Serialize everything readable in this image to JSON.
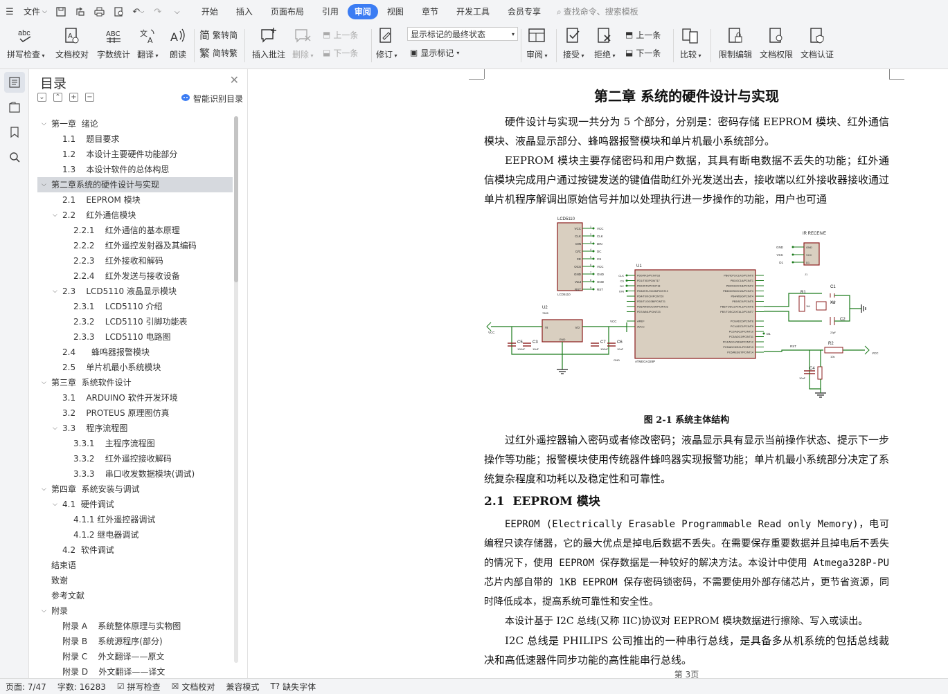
{
  "menubar": {
    "file_label": "文件",
    "tabs": [
      "开始",
      "插入",
      "页面布局",
      "引用",
      "审阅",
      "视图",
      "章节",
      "开发工具",
      "会员专享"
    ],
    "active_tab": "审阅",
    "search_placeholder": "查找命令、搜索模板"
  },
  "ribbon": {
    "spell_check": "拼写检查",
    "doc_proof": "文档校对",
    "word_count": "字数统计",
    "translate": "翻译",
    "read_aloud": "朗读",
    "trad_to_simp": "繁转简",
    "simp_to_trad": "简转繁",
    "insert_comment": "插入批注",
    "delete": "删除",
    "prev_comment": "上一条",
    "next_comment": "下一条",
    "revise": "修订",
    "markup_select": "显示标记的最终状态",
    "show_markup": "显示标记",
    "review": "审阅",
    "accept": "接受",
    "reject": "拒绝",
    "prev_change": "上一条",
    "next_change": "下一条",
    "compare": "比较",
    "restrict_edit": "限制编辑",
    "doc_permission": "文档权限",
    "doc_auth": "文档认证"
  },
  "toc": {
    "title": "目录",
    "smart_label": "智能识别目录",
    "items": [
      {
        "label": "第一章  绪论",
        "level": 0,
        "arrow": "v"
      },
      {
        "label": "1.1    题目要求",
        "level": 1
      },
      {
        "label": "1.2    本设计主要硬件功能部分",
        "level": 1
      },
      {
        "label": "1.3    本设计软件的总体构思",
        "level": 1
      },
      {
        "label": "第二章系统的硬件设计与实现",
        "level": 0,
        "arrow": "v",
        "selected": true
      },
      {
        "label": "2.1    EEPROM 模块",
        "level": 1
      },
      {
        "label": "2.2    红外通信模块",
        "level": 1,
        "arrow": "v"
      },
      {
        "label": "2.2.1    红外通信的基本原理",
        "level": 2
      },
      {
        "label": "2.2.2    红外遥控发射器及其编码",
        "level": 2
      },
      {
        "label": "2.2.3    红外接收和解码",
        "level": 2
      },
      {
        "label": "2.2.4    红外发送与接收设备",
        "level": 2
      },
      {
        "label": "2.3    LCD5110 液晶显示模块",
        "level": 1,
        "arrow": "v"
      },
      {
        "label": "2.3.1    LCD5110 介绍",
        "level": 2
      },
      {
        "label": "2.3.2    LCD5110 引脚功能表",
        "level": 2
      },
      {
        "label": "2.3.3    LCD5110 电路图",
        "level": 2
      },
      {
        "label": "2.4      蜂鸣器报警模块",
        "level": 1
      },
      {
        "label": "2.5    单片机最小系统模块",
        "level": 1
      },
      {
        "label": "第三章  系统软件设计",
        "level": 0,
        "arrow": "v"
      },
      {
        "label": "3.1    ARDUINO 软件开发环境",
        "level": 1
      },
      {
        "label": "3.2    PROTEUS 原理图仿真",
        "level": 1
      },
      {
        "label": "3.3    程序流程图",
        "level": 1,
        "arrow": "v"
      },
      {
        "label": "3.3.1    主程序流程图",
        "level": 2
      },
      {
        "label": "3.3.2    红外遥控接收解码",
        "level": 2
      },
      {
        "label": "3.3.3    串口收发数据模块(调试)",
        "level": 2
      },
      {
        "label": "第四章  系统安装与调试",
        "level": 0,
        "arrow": "v"
      },
      {
        "label": "4.1  硬件调试",
        "level": 1,
        "arrow": "v"
      },
      {
        "label": "4.1.1 红外遥控器调试",
        "level": 2
      },
      {
        "label": "4.1.2 继电器调试",
        "level": 2
      },
      {
        "label": "4.2  软件调试",
        "level": 1
      },
      {
        "label": "结束语",
        "level": 0
      },
      {
        "label": "致谢",
        "level": 0
      },
      {
        "label": "参考文献",
        "level": 0
      },
      {
        "label": "附录",
        "level": 0,
        "arrow": "v"
      },
      {
        "label": "附录 A    系统整体原理与实物图",
        "level": 1
      },
      {
        "label": "附录 B    系统源程序(部分)",
        "level": 1
      },
      {
        "label": "附录 C    外文翻译——原文",
        "level": 1
      },
      {
        "label": "附录 D    外文翻译——译文",
        "level": 1
      }
    ]
  },
  "doc": {
    "chapter_title": "第二章 系统的硬件设计与实现",
    "p1": "硬件设计与实现一共分为 5 个部分，分别是：密码存储 EEPROM 模块、红外通信模块、液晶显示部分、蜂鸣器报警模块和单片机最小系统部分。",
    "p2": "EEPROM 模块主要存储密码和用户数据，其具有断电数据不丢失的功能；红外通信模块完成用户通过按键发送的键值借助红外光发送出去，接收端以红外接收器接收通过单片机程序解调出原始信号并加以处理执行进一步操作的功能，用户也可通",
    "figure_caption": "图 2-1 系统主体结构",
    "p3": "过红外遥控器输入密码或者修改密码；液晶显示具有显示当前操作状态、提示下一步操作等功能；报警模块使用传统器件蜂鸣器实现报警功能；单片机最小系统部分决定了系统复杂程度和功耗以及稳定性和可靠性。",
    "section_title": "2.1  EEPROM 模块",
    "p4": "EEPROM (Electrically Erasable Programmable Read only Memory)，电可编程只读存储器，它的最大优点是掉电后数据不丢失。在需要保存重要数据并且掉电后不丢失的情况下，使用 EEPROM 保存数据是一种较好的解决方法。本设计中使用 Atmega328P-PU 芯片内部自带的 1KB EEPROM 保存密码锁密码，不需要使用外部存储芯片，更节省资源，同时降低成本，提高系统可靠性和安全性。",
    "p5": "本设计基于 I2C 总线(又称 IIC)协议对 EEPROM 模块数据进行擦除、写入或读出。",
    "p6": "I2C 总线是 PHILIPS 公司推出的一种串行总线，是具备多从机系统的包括总线裁决和高低速器件同步功能的高性能串行总线。",
    "page_footer": "第 3页"
  },
  "schematic": {
    "lcd_label": "LCD5110",
    "lcd_pins": [
      "VCC",
      "CLK",
      "DIN",
      "D/C",
      "CE",
      "OCS",
      "GND",
      "Vout",
      "RST"
    ],
    "lcd_nets": [
      "VCC",
      "CLK",
      "DIN",
      "DC",
      "CS",
      "VCC",
      "GND",
      "GND",
      "RST"
    ],
    "lcd_part": "LCD5110",
    "ir_label": "IR RECEIVE",
    "ir_pins": [
      "GND",
      "VCC",
      "D1"
    ],
    "ir_nets": [
      "GND",
      "VCC",
      "D1"
    ],
    "ir_part": "J1",
    "mcu_ref": "U1",
    "mcu_part": "ATMEGA328P",
    "mcu_left_pins": [
      "PD0/RXD/PCINT16",
      "PD1/TXD/PCINT17",
      "PD2/INT0/PCINT18",
      "PD3/INT1/OC2B/PCINT19",
      "PD4/T0/XCK/PCINT20",
      "PD5/T1/OC0B/PCINT21",
      "PD6/AIN0/OC0A/PCINT22",
      "PD7/AIN1/PCINT23"
    ],
    "mcu_left_pins2": [
      "AREF",
      "AVCC"
    ],
    "mcu_right_pins": [
      "PB0/ICP1/CLKO/PCINT0",
      "PB1/OC1A/PCINT1",
      "PB2/SS/OC1B/PCINT2",
      "PB3/MOSI/OC2A/PCINT3",
      "PB4/MISO/PCINT4",
      "PB5/SCK/PCINT5",
      "PB6/TOSC1/XTAL1/PCINT6",
      "PB7/TOSC2/XTAL2/PCINT7"
    ],
    "mcu_right_pins2": [
      "PC0/ADC0/PCINT8",
      "PC1/ADC1/PCINT9",
      "PC2/ADC2/PCINT10",
      "PC3/ADC3/PCINT11",
      "PC4/ADC4/SDA/PCINT12",
      "PC5/ADC5/SCL/PCINT13",
      "PC6/RESET/PCINT14"
    ],
    "mcu_left_nets": [
      "CLK",
      "CS",
      "DC",
      "DIN"
    ],
    "reg_ref": "U2",
    "reg_part": "7805",
    "reg_vi": "VI",
    "reg_vo": "VO",
    "reg_gnd": "GND",
    "vcc": "VCC",
    "c5": "C5",
    "c5v": "100nF",
    "c3": "C3",
    "c3v": "10uF",
    "c7": "C7",
    "c7v": "100nF",
    "c6": "C6",
    "c6v": "10uF",
    "gnd": "GND",
    "r1": "R1",
    "r1v": "1M",
    "c1": "C1",
    "c1v": "22pF",
    "c2": "C2",
    "c2v": "22pF",
    "x1": "X1",
    "d1": "D1",
    "rst": "RST",
    "r2": "R2",
    "r2v": "10k",
    "c4": "C4",
    "c4v": "10uF"
  },
  "status": {
    "page": "页面: 7/47",
    "words": "字数: 16283",
    "spell": "拼写检查",
    "proof": "文档校对",
    "compat": "兼容模式",
    "missing_font": "缺失字体"
  },
  "colors": {
    "accent": "#3b7cf3",
    "wire": "#1a7a1a",
    "component": "#8b1c1c",
    "chip_fill": "#d9cfc0"
  }
}
